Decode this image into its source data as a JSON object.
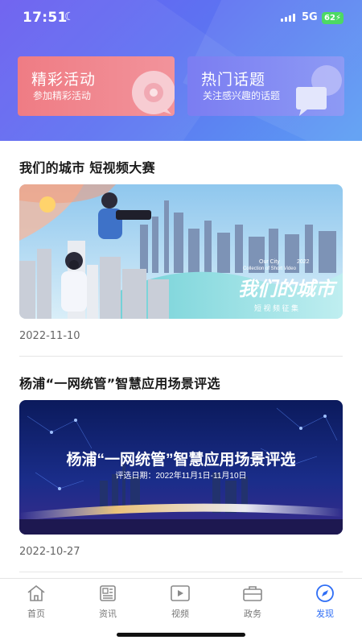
{
  "status_bar": {
    "time": "17:51",
    "network": "5G",
    "battery": "62"
  },
  "cards": [
    {
      "title": "精彩活动",
      "subtitle": "参加精彩活动"
    },
    {
      "title": "热门话题",
      "subtitle": "关注感兴趣的话题"
    }
  ],
  "articles": [
    {
      "title": "我们的城市 短视频大赛",
      "date": "2022-11-10",
      "banner": {
        "en_line1": "Our City",
        "en_line2": "Collection of Short Video",
        "year": "2022",
        "title": "我们的城市",
        "subtitle": "短 视 频 征 集"
      }
    },
    {
      "title": "杨浦“一网统管”智慧应用场景评选",
      "date": "2022-10-27",
      "banner": {
        "title": "杨浦“一网统管”智慧应用场景评选",
        "subtitle": "评选日期：2022年11月1日-11月10日"
      }
    }
  ],
  "tabbar": [
    {
      "label": "首页",
      "icon": "home-icon"
    },
    {
      "label": "资讯",
      "icon": "news-icon"
    },
    {
      "label": "视频",
      "icon": "video-icon"
    },
    {
      "label": "政务",
      "icon": "briefcase-icon"
    },
    {
      "label": "发现",
      "icon": "compass-icon",
      "active": true
    }
  ],
  "colors": {
    "accent": "#2f6ef5",
    "activity_card": "#ef7c84",
    "topics_card": "#7b7df2"
  }
}
